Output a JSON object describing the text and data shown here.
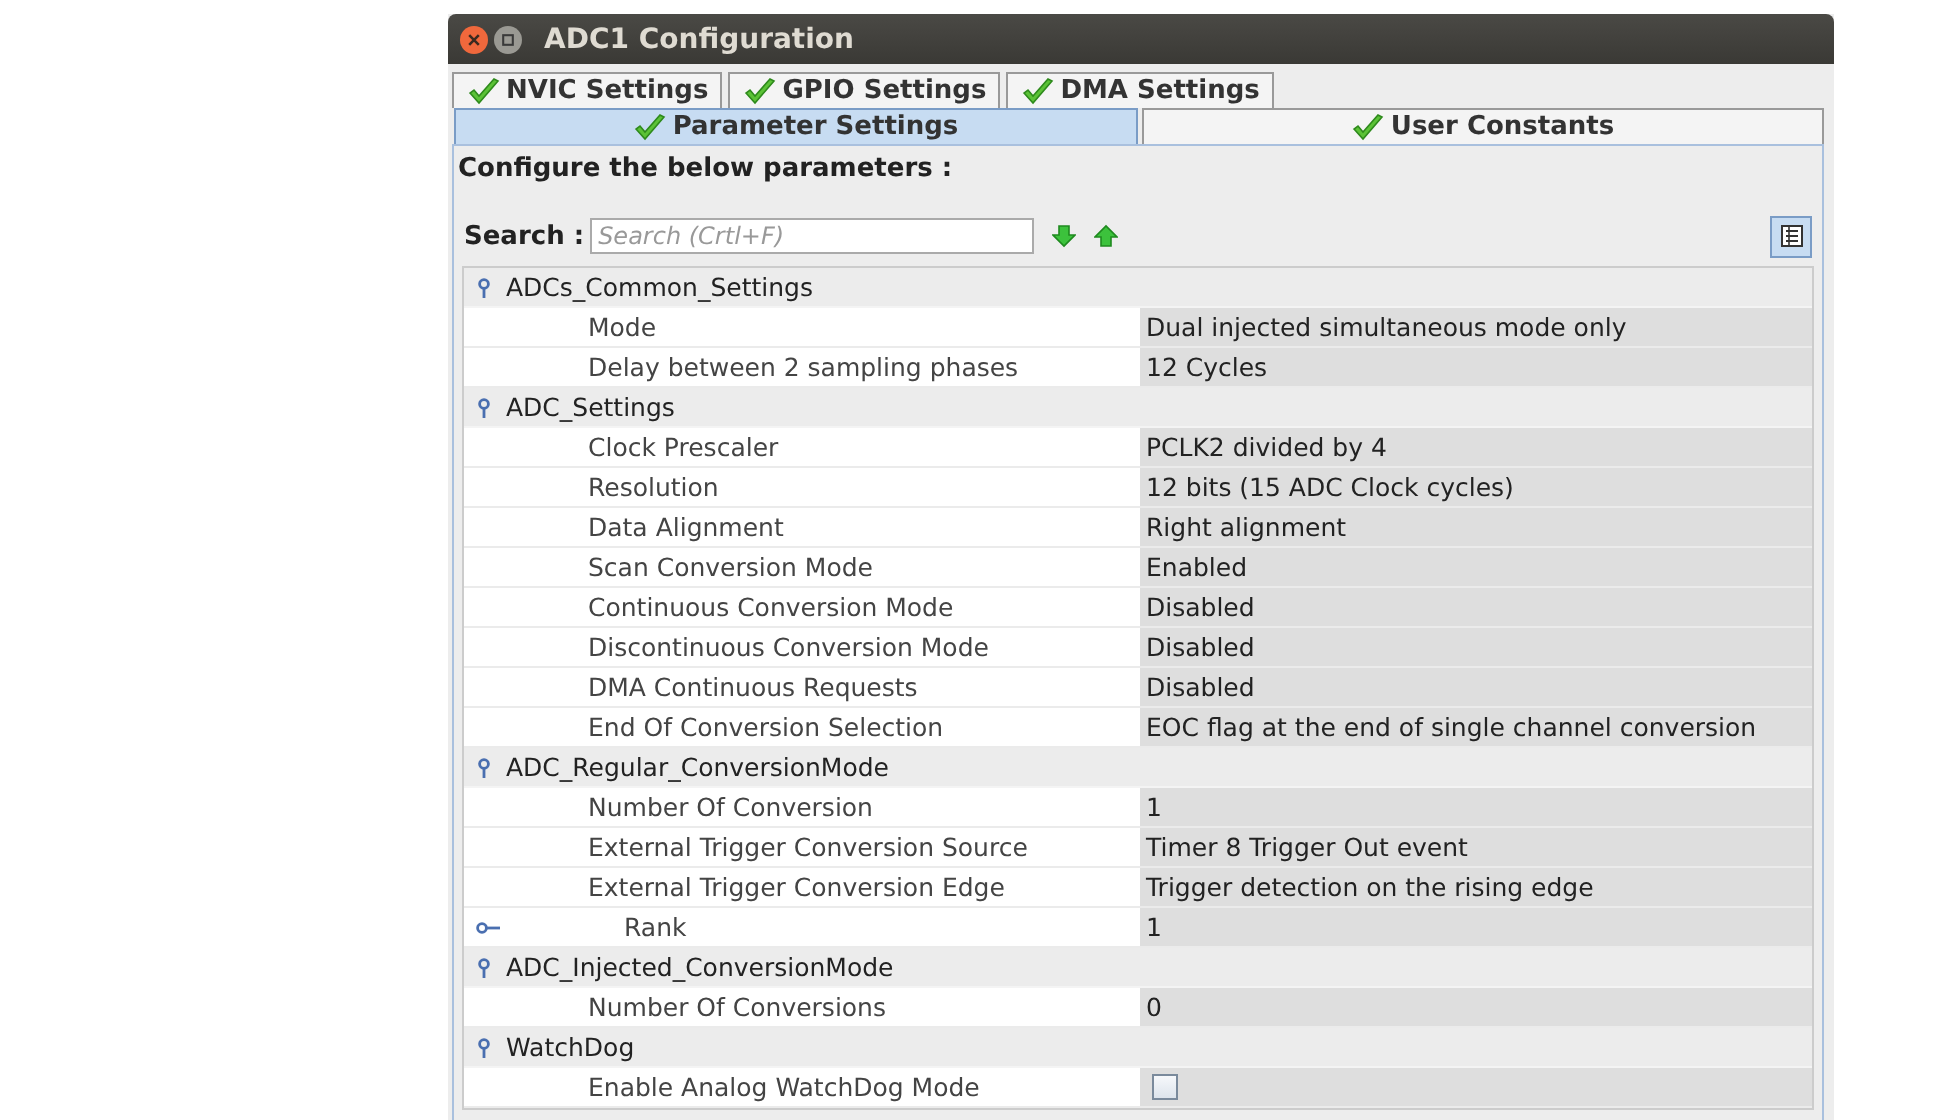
{
  "window": {
    "title": "ADC1 Configuration"
  },
  "tabs_top": [
    {
      "label": "NVIC Settings",
      "selected": false
    },
    {
      "label": "GPIO Settings",
      "selected": false
    },
    {
      "label": "DMA Settings",
      "selected": false
    }
  ],
  "tabs_bottom": [
    {
      "label": "Parameter Settings",
      "selected": true
    },
    {
      "label": "User Constants",
      "selected": false
    }
  ],
  "heading": "Configure the below parameters :",
  "search": {
    "label": "Search :",
    "placeholder": "Search (Crtl+F)"
  },
  "groups": [
    {
      "name": "ADCs_Common_Settings",
      "expanded": true,
      "children": [
        {
          "kind": "text",
          "name": "Mode",
          "value": "Dual injected simultaneous mode only"
        },
        {
          "kind": "text",
          "name": "Delay between 2 sampling phases",
          "value": "12 Cycles"
        }
      ]
    },
    {
      "name": "ADC_Settings",
      "expanded": true,
      "children": [
        {
          "kind": "text",
          "name": "Clock Prescaler",
          "value": "PCLK2 divided by 4"
        },
        {
          "kind": "text",
          "name": "Resolution",
          "value": "12 bits (15 ADC Clock cycles)"
        },
        {
          "kind": "text",
          "name": "Data Alignment",
          "value": "Right alignment"
        },
        {
          "kind": "text",
          "name": "Scan Conversion Mode",
          "value": "Enabled"
        },
        {
          "kind": "text",
          "name": "Continuous Conversion Mode",
          "value": "Disabled"
        },
        {
          "kind": "text",
          "name": "Discontinuous Conversion Mode",
          "value": "Disabled"
        },
        {
          "kind": "text",
          "name": "DMA Continuous Requests",
          "value": "Disabled"
        },
        {
          "kind": "text",
          "name": "End Of Conversion Selection",
          "value": "EOC flag at the end of single channel conversion"
        }
      ]
    },
    {
      "name": "ADC_Regular_ConversionMode",
      "expanded": true,
      "children": [
        {
          "kind": "text",
          "name": "Number Of Conversion",
          "value": "1"
        },
        {
          "kind": "text",
          "name": "External Trigger Conversion Source",
          "value": "Timer 8 Trigger Out event"
        },
        {
          "kind": "text",
          "name": "External Trigger Conversion Edge",
          "value": "Trigger detection on the rising edge"
        },
        {
          "kind": "node",
          "name": "Rank",
          "value": "1",
          "expanded": false
        }
      ]
    },
    {
      "name": "ADC_Injected_ConversionMode",
      "expanded": true,
      "children": [
        {
          "kind": "text",
          "name": "Number Of Conversions",
          "value": "0"
        }
      ]
    },
    {
      "name": "WatchDog",
      "expanded": true,
      "children": [
        {
          "kind": "checkbox",
          "name": "Enable Analog WatchDog Mode",
          "checked": false
        }
      ]
    }
  ]
}
